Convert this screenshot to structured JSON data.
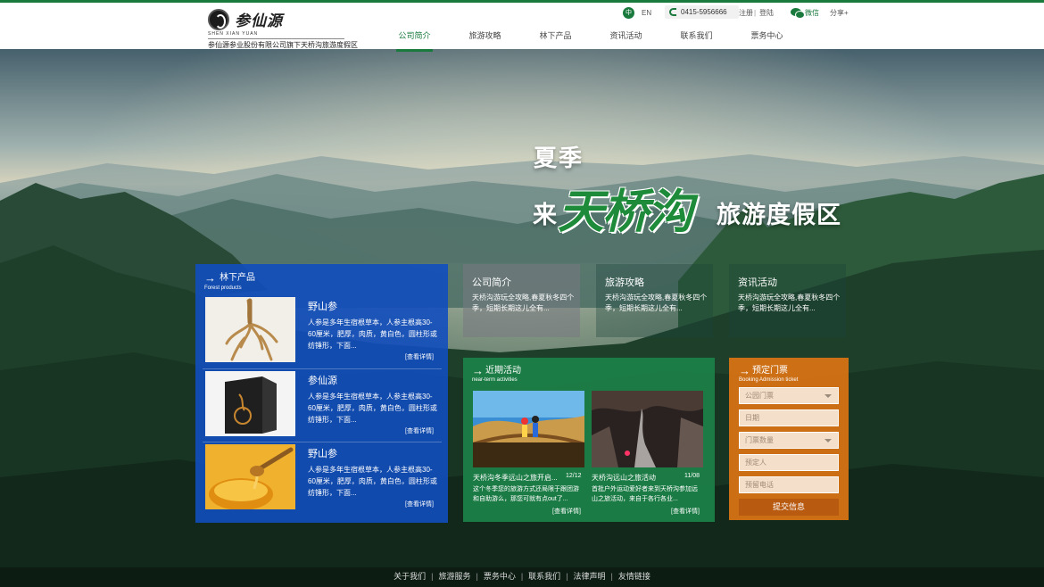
{
  "header": {
    "logo_title": "参仙源",
    "logo_pinyin": "SHEN XIAN YUAN",
    "logo_subtitle": "参仙源参业股份有限公司旗下天桥沟旅游度假区",
    "lang_zh": "中",
    "lang_en": "EN",
    "phone": "0415-5956666",
    "register": "注册",
    "separator": "|",
    "login": "登陆",
    "wechat": "微信",
    "share": "分享+"
  },
  "nav": {
    "items": [
      {
        "label": "公司简介",
        "active": true
      },
      {
        "label": "旅游攻略",
        "active": false
      },
      {
        "label": "林下产品",
        "active": false
      },
      {
        "label": "资讯活动",
        "active": false
      },
      {
        "label": "联系我们",
        "active": false
      },
      {
        "label": "票务中心",
        "active": false
      }
    ]
  },
  "hero": {
    "line1": "夏季",
    "prefix": "来",
    "name": "天桥沟",
    "suffix": "旅游度假区"
  },
  "forest": {
    "arrow": "→",
    "title": "林下产品",
    "subtitle": "Forest products",
    "products": [
      {
        "name": "野山参",
        "desc": "人参是多年生宿根草本，人参主根高30-60厘米，肥厚，肉质，黄白色，圆柱形或纺锤形，下面...",
        "more": "[查看详情]"
      },
      {
        "name": "参仙源",
        "desc": "人参是多年生宿根草本，人参主根高30-60厘米，肥厚，肉质，黄白色，圆柱形或纺锤形，下面...",
        "more": "[查看详情]"
      },
      {
        "name": "野山参",
        "desc": "人参是多年生宿根草本，人参主根高30-60厘米，肥厚，肉质，黄白色，圆柱形或纺锤形，下面...",
        "more": "[查看详情]"
      }
    ]
  },
  "tiles": [
    {
      "title": "公司简介",
      "desc": "天桥沟游玩全攻略,春夏秋冬四个季，短期长期这儿全有..."
    },
    {
      "title": "旅游攻略",
      "desc": "天桥沟游玩全攻略,春夏秋冬四个季，短期长期这儿全有..."
    },
    {
      "title": "资讯活动",
      "desc": "天桥沟游玩全攻略,春夏秋冬四个季，短期长期这儿全有..."
    }
  ],
  "news": {
    "arrow": "→",
    "title": "近期活动",
    "subtitle": "near-term activities",
    "items": [
      {
        "title": "天桥沟冬季远山之旅开启...",
        "date": "12/12",
        "desc": "这个冬季您的旅游方式还局限于跟团游和自助游么，那您可就有点out了...",
        "more": "[查看详情]"
      },
      {
        "title": "天桥沟远山之旅活动",
        "date": "11/08",
        "desc": "首批户外运动爱好者来到天桥沟参加远山之旅活动，来自于各行各业...",
        "more": "[查看详情]"
      }
    ]
  },
  "ticket": {
    "arrow": "→",
    "title": "预定门票",
    "subtitle": "Booking Admission ticket",
    "fields": {
      "park": "公园门票",
      "date": "日期",
      "quantity": "门票数量",
      "booker": "预定人",
      "phone": "预留电话"
    },
    "submit": "提交信息"
  },
  "footer": {
    "links": [
      "关于我们",
      "旅游服务",
      "票务中心",
      "联系我们",
      "法律声明",
      "友情链接"
    ],
    "sep": "|"
  },
  "colors": {
    "brand_green": "#1a7a3e",
    "forest_blue": "#124ebe",
    "news_green": "#1c8048",
    "ticket_orange": "#d67214"
  }
}
